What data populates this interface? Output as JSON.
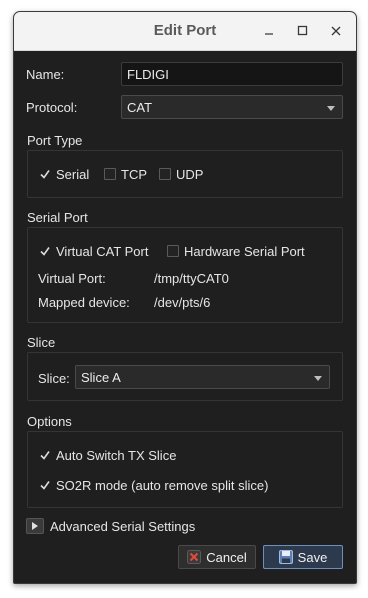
{
  "window": {
    "title": "Edit Port",
    "controls": [
      "minimize",
      "maximize",
      "close"
    ]
  },
  "form": {
    "name_label": "Name:",
    "name_value": "FLDIGI",
    "protocol_label": "Protocol:",
    "protocol_value": "CAT"
  },
  "port_type": {
    "title": "Port Type",
    "options": [
      {
        "label": "Serial",
        "checked": true
      },
      {
        "label": "TCP",
        "checked": false
      },
      {
        "label": "UDP",
        "checked": false
      }
    ]
  },
  "serial_port": {
    "title": "Serial Port",
    "virtual_cat_label": "Virtual CAT Port",
    "virtual_cat_checked": true,
    "hardware_label": "Hardware Serial Port",
    "hardware_checked": false,
    "virtual_port_label": "Virtual Port:",
    "virtual_port_value": "/tmp/ttyCAT0",
    "mapped_device_label": "Mapped device:",
    "mapped_device_value": "/dev/pts/6"
  },
  "slice": {
    "title": "Slice",
    "slice_label": "Slice:",
    "slice_value": "Slice A"
  },
  "options": {
    "title": "Options",
    "auto_switch_label": "Auto Switch TX Slice",
    "auto_switch_checked": true,
    "so2r_label": "SO2R mode (auto remove split slice)",
    "so2r_checked": true
  },
  "advanced": {
    "label": "Advanced Serial Settings"
  },
  "buttons": {
    "cancel_label": "Cancel",
    "save_label": "Save"
  },
  "colors": {
    "background": "#1f1f1f",
    "titlebar": "#f3f3f3",
    "save_border": "#6d8fbd",
    "cancel_icon": "#e04b3a"
  }
}
